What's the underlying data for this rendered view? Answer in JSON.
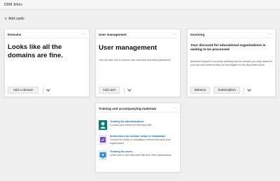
{
  "app": {
    "title": "DDM Jirkov"
  },
  "toolbar": {
    "add_cards_label": "Add cards"
  },
  "cards": {
    "domains": {
      "title": "Domains",
      "headline": "Looks like all the domains are fine.",
      "button": "Add a domain"
    },
    "user_management": {
      "title": "User management",
      "headline": "User management",
      "description": "You can add, edit or remove user accounts and reset passwords.",
      "button": "Add user"
    },
    "invoicing": {
      "title": "Invoicing",
      "headline": "Your discount for educational organizations is waiting to be processed",
      "description": "Microsoft Support is currently verifying that the domain you have added to your account confirms that you are eligible for the discounted price.",
      "button_balance": "Balance",
      "button_subscription": "Subscription"
    },
    "training": {
      "title": "Training and accompanying materials",
      "items": [
        {
          "title": "Training for administrators",
          "subtitle": "Courses and videos for Microsoft 365",
          "icon": "admin-training-icon",
          "color": "#0b7a74"
        },
        {
          "title": "Instructions for custom setup or installation",
          "subtitle": "Choose the setup or installation method that suits your organization",
          "icon": "setup-instructions-icon",
          "color": "#6b4fbb"
        },
        {
          "title": "Training for users",
          "subtitle": "Learn how to use Microsoft 365 and Office applications.",
          "icon": "user-training-icon",
          "color": "#2b88d8"
        }
      ]
    }
  },
  "colors": {
    "accent": "#0f6cbd",
    "background": "#efefef"
  }
}
